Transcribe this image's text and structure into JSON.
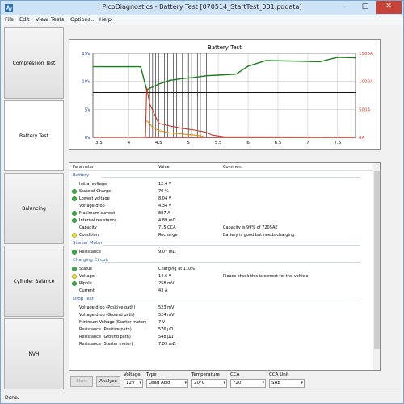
{
  "window": {
    "title": "PicoDiagnostics - Battery Test [070514_StartTest_001.pddata]",
    "minimize_glyph": "–",
    "maximize_glyph": "□",
    "close_glyph": "✕"
  },
  "menu": [
    "File",
    "Edit",
    "View",
    "Tests",
    "Options...",
    "Help"
  ],
  "sidebar": [
    {
      "label": "Compression Test"
    },
    {
      "label": "Battery Test"
    },
    {
      "label": "Balancing"
    },
    {
      "label": "Cylinder Balance"
    },
    {
      "label": "NVH"
    }
  ],
  "chart_data": {
    "type": "line",
    "title": "Battery Test",
    "x_ticks": [
      "3.5",
      "4",
      "4.5",
      "5",
      "5.5",
      "6",
      "6.5",
      "7",
      "7.5"
    ],
    "xlim": [
      3.4,
      7.8
    ],
    "y_left_ticks": [
      "0V",
      "5V",
      "10V",
      "15V"
    ],
    "ylim_left": [
      0,
      15
    ],
    "y_right_ticks": [
      "0A",
      "500A",
      "1000A",
      "1500A"
    ],
    "ylim_right": [
      0,
      1500
    ],
    "markers_x": [
      4.35,
      4.4,
      4.45,
      4.5,
      4.6,
      4.65,
      4.75,
      4.8,
      4.9,
      5.0,
      5.05,
      5.15,
      5.2,
      5.3
    ],
    "series": [
      {
        "color": "#1e7a1e",
        "x": [
          3.4,
          4.2,
          4.3,
          4.5,
          4.7,
          4.9,
          5.1,
          5.3,
          5.5,
          5.8,
          6.0,
          6.3,
          6.8,
          7.2,
          7.5,
          7.8
        ],
        "values": [
          12.6,
          12.6,
          8.5,
          9.5,
          10.2,
          10.5,
          10.7,
          11.0,
          11.1,
          11.3,
          12.7,
          13.7,
          13.6,
          13.5,
          14.3,
          14.2
        ]
      },
      {
        "color": "#c0392b",
        "x": [
          3.4,
          4.28,
          4.3,
          4.35,
          4.5,
          4.7,
          4.9,
          5.1,
          5.3,
          5.4,
          5.6,
          7.8
        ],
        "values": [
          0,
          0,
          887,
          600,
          250,
          200,
          160,
          130,
          90,
          40,
          10,
          5
        ]
      },
      {
        "color": "#e08a00",
        "x": [
          4.3,
          4.4,
          4.5,
          4.7,
          4.9,
          5.1,
          5.25
        ],
        "values": [
          300,
          180,
          120,
          80,
          60,
          40,
          20
        ]
      }
    ],
    "ref_lines_left": [
      8
    ],
    "ref_lines_right": [
      0
    ]
  },
  "table": {
    "headers": [
      "Parameter",
      "Value",
      "Comment"
    ],
    "groups": [
      {
        "name": "Battery",
        "rows": [
          {
            "dot": "",
            "name": "Initial voltage",
            "value": "12.4 V",
            "comment": ""
          },
          {
            "dot": "#3cb043",
            "name": "State of Charge",
            "value": "70 %",
            "comment": ""
          },
          {
            "dot": "#3cb043",
            "name": "Lowest voltage",
            "value": "8.04 V",
            "comment": ""
          },
          {
            "dot": "",
            "name": "Voltage drop",
            "value": "4.34 V",
            "comment": ""
          },
          {
            "dot": "#3cb043",
            "name": "Maximum current",
            "value": "887 A",
            "comment": ""
          },
          {
            "dot": "#3cb043",
            "name": "Internal resistance",
            "value": "4.89 mΩ",
            "comment": ""
          },
          {
            "dot": "",
            "name": "Capacity",
            "value": "715 CCA",
            "comment": "Capacity is 99% of 720SAE"
          },
          {
            "dot": "#f2e14c",
            "name": "Condition",
            "value": "Recharge",
            "comment": "Battery is good but needs charging."
          }
        ]
      },
      {
        "name": "Starter Motor",
        "rows": [
          {
            "dot": "#3cb043",
            "name": "Resistance",
            "value": "9.07 mΩ",
            "comment": ""
          }
        ]
      },
      {
        "name": "Charging Circuit",
        "rows": [
          {
            "dot": "#3cb043",
            "name": "Status",
            "value": "Charging at 110%",
            "comment": ""
          },
          {
            "dot": "#f2e14c",
            "name": "Voltage",
            "value": "14.6 V",
            "comment": "Please check this is correct for the vehicle"
          },
          {
            "dot": "#3cb043",
            "name": "Ripple",
            "value": "258 mV",
            "comment": ""
          },
          {
            "dot": "",
            "name": "Current",
            "value": "43 A",
            "comment": ""
          }
        ]
      },
      {
        "name": "Drop Test",
        "rows": [
          {
            "dot": "",
            "name": "Voltage drop (Positive path)",
            "value": "523 mV",
            "comment": ""
          },
          {
            "dot": "",
            "name": "Voltage drop (Ground path)",
            "value": "524 mV",
            "comment": ""
          },
          {
            "dot": "",
            "name": "Minimum Voltage (Starter motor)",
            "value": "7 V",
            "comment": ""
          },
          {
            "dot": "",
            "name": "Resistance (Positive path)",
            "value": "576 µΩ",
            "comment": ""
          },
          {
            "dot": "",
            "name": "Resistance (Ground path)",
            "value": "548 µΩ",
            "comment": ""
          },
          {
            "dot": "",
            "name": "Resistance (Starter motor)",
            "value": "7.89 mΩ",
            "comment": ""
          }
        ]
      }
    ]
  },
  "bottom": {
    "start_label": "Start",
    "analyse_label": "Analyse",
    "voltage_label": "Voltage",
    "voltage_value": "12V",
    "type_label": "Type",
    "type_value": "Lead Acid",
    "temperature_label": "Temperature",
    "temperature_value": "20°C",
    "cca_label": "CCA",
    "cca_value": "720",
    "cca_unit_label": "CCA Unit",
    "cca_unit_value": "SAE",
    "dropdown_glyph": "▾"
  },
  "status": "Done."
}
